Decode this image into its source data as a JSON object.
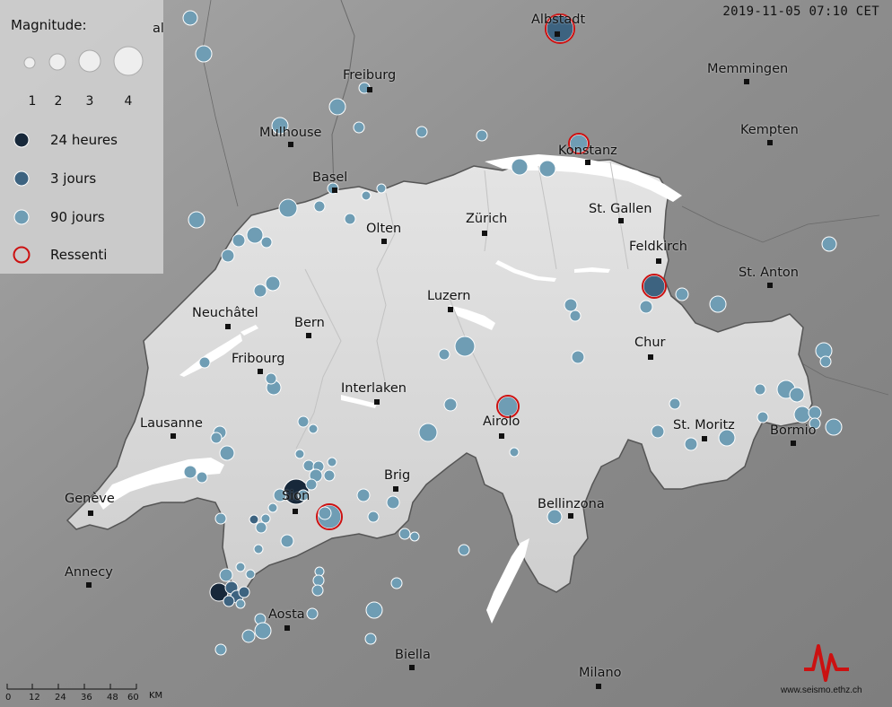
{
  "timestamp": "2019-11-05 07:10 CET",
  "legend": {
    "title": "Magnitude:",
    "magnitudes": [
      "1",
      "2",
      "3",
      "4"
    ],
    "categories": [
      {
        "label": "24 heures",
        "color": "#17283a"
      },
      {
        "label": "3 jours",
        "color": "#3d6380"
      },
      {
        "label": "90 jours",
        "color": "#6f9db4"
      },
      {
        "label": "Ressenti",
        "color": "#cc1111"
      }
    ]
  },
  "cities": [
    {
      "name": "Albstadt"
    },
    {
      "name": "Freiburg"
    },
    {
      "name": "Memmingen"
    },
    {
      "name": "Mulhouse"
    },
    {
      "name": "Konstanz"
    },
    {
      "name": "Kempten"
    },
    {
      "name": "Basel"
    },
    {
      "name": "Zürich"
    },
    {
      "name": "St. Gallen"
    },
    {
      "name": "Olten"
    },
    {
      "name": "Feldkirch"
    },
    {
      "name": "St. Anton"
    },
    {
      "name": "Luzern"
    },
    {
      "name": "Neuchâtel"
    },
    {
      "name": "Bern"
    },
    {
      "name": "Chur"
    },
    {
      "name": "Fribourg"
    },
    {
      "name": "Interlaken"
    },
    {
      "name": "Lausanne"
    },
    {
      "name": "Airolo"
    },
    {
      "name": "St. Moritz"
    },
    {
      "name": "Bormio"
    },
    {
      "name": "Brig"
    },
    {
      "name": "Sion"
    },
    {
      "name": "Genève"
    },
    {
      "name": "Bellinzona"
    },
    {
      "name": "Annecy"
    },
    {
      "name": "Aosta"
    },
    {
      "name": "Biella"
    },
    {
      "name": "Milano"
    }
  ],
  "partial_label": "al",
  "scale": {
    "ticks": [
      "0",
      "12",
      "24",
      "36",
      "48",
      "60"
    ],
    "unit": "KM"
  },
  "credit": "www.seismo.ethz.ch",
  "colors": {
    "land": "#dcdcdc",
    "outside": "#8f8f8f",
    "lakes": "#ffffff",
    "ressenti": "#cc1111"
  }
}
